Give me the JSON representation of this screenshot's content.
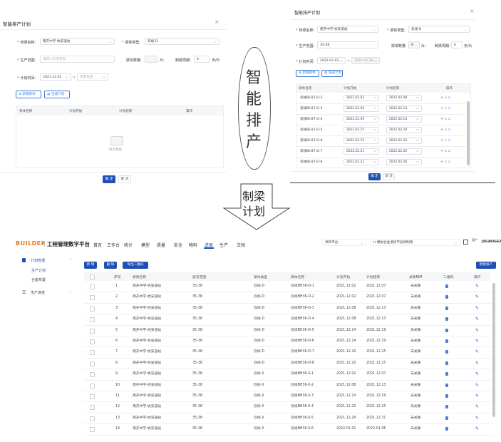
{
  "left_dialog": {
    "title": "智能排产计划",
    "bridge_label": "桥梁名称:",
    "bridge_value": "南开中学-杭安道站",
    "type_label": "梁体类型:",
    "type_value": "双线-D",
    "range_label": "生产范围:",
    "range_placeholder": "请输入桩号范围",
    "count_label": "梁体数量:",
    "count_unit": "片;",
    "cycle_label": "制梁周期:",
    "cycle_value": "6",
    "cycle_unit": "天/片",
    "time_label": "计划时间:",
    "time_start": "2021.12.02",
    "time_end_placeholder": "结束日期",
    "add_btn": "新增梁体",
    "gen_btn": "生成计划",
    "col_name": "梁体名称",
    "col_start": "计划开始",
    "col_end": "计划结束",
    "col_op": "操作",
    "empty_text": "暂无数据",
    "ok_btn": "确 定",
    "cancel_btn": "取 消"
  },
  "center_label": [
    "智",
    "能",
    "排",
    "产"
  ],
  "arrow_label": [
    "制梁",
    "计划"
  ],
  "right_dialog": {
    "title": "智能排产计划",
    "bridge_label": "桥梁名称:",
    "bridge_value": "南开中学-杭安道站",
    "type_label": "梁体类型:",
    "type_value": "双线-D",
    "range_label": "生产范围:",
    "range_value": "35-38",
    "count_label": "梁体数量:",
    "count_value": "8",
    "count_unit": "片;",
    "cycle_label": "制梁周期:",
    "cycle_value": "6",
    "cycle_unit": "天/片",
    "time_label": "计划时间:",
    "time_start": "2022.02.03",
    "time_end": "2022.02.26",
    "add_btn": "新增梁体",
    "gen_btn": "生成计划",
    "col_name": "梁体名称",
    "col_start": "计划开始",
    "col_end": "计划结束",
    "col_op": "操作",
    "rows": [
      {
        "name": "双线BH37-D-2",
        "start": "2022.02.03",
        "end": "2022.02.08"
      },
      {
        "name": "双线BH37-D-3",
        "start": "2022.02.09",
        "end": "2022.02.14"
      },
      {
        "name": "双线BH37-D-4",
        "start": "2022.02.09",
        "end": "2022.02.14"
      },
      {
        "name": "双线BH37-D-5",
        "start": "2022.02.15",
        "end": "2022.02.20"
      },
      {
        "name": "双线BH37-D-6",
        "start": "2022.02.15",
        "end": "2022.02.20"
      },
      {
        "name": "双线BH37-D-7",
        "start": "2022.02.21",
        "end": "2022.02.26"
      },
      {
        "name": "双线BH37-D-8",
        "start": "2022.02.21",
        "end": "2022.02.26"
      }
    ],
    "ok_btn": "确 定",
    "cancel_btn": "取 消"
  },
  "app": {
    "brand": "BUILDER",
    "product": "工程管理数字平台",
    "nav": [
      "首页",
      "工作台",
      "统计",
      "模型",
      "质量",
      "安全",
      "物料",
      "进度",
      "生产",
      "文档"
    ],
    "active_nav": "进度",
    "project_select": "项目平台",
    "path_select": "U 横他合金道桥节段预制场",
    "user_name": "用户",
    "user_id": "J563026627",
    "side_menu": [
      {
        "label": "计划管理",
        "children": [
          "生产计划",
          "台座布置"
        ]
      },
      {
        "label": "生产进度",
        "children": []
      }
    ],
    "toolbar": {
      "add": "新 增",
      "delete": "删 除",
      "export": "导出二维码",
      "smart": "智能排产"
    },
    "columns": [
      "序号",
      "桥梁名称",
      "桩号范围",
      "梁体类型",
      "梁体名称",
      "计划开始",
      "计划结束",
      "关联BIM",
      "二维码",
      "操作"
    ],
    "rows": [
      {
        "no": "1",
        "bridge": "南开中学-杭安道站",
        "range": "35-38",
        "type": "双线-D",
        "name": "双线BH36-D-1",
        "start": "2021.12.02",
        "end": "2021.12.07",
        "bim": "未关联"
      },
      {
        "no": "2",
        "bridge": "南开中学-杭安道站",
        "range": "35-38",
        "type": "双线-D",
        "name": "双线BH36-D-2",
        "start": "2021.12.02",
        "end": "2021.12.07",
        "bim": "未关联"
      },
      {
        "no": "3",
        "bridge": "南开中学-杭安道站",
        "range": "35-38",
        "type": "双线-D",
        "name": "双线BH36-D-3",
        "start": "2021.12.08",
        "end": "2021.12.13",
        "bim": "未关联"
      },
      {
        "no": "4",
        "bridge": "南开中学-杭安道站",
        "range": "35-38",
        "type": "双线-D",
        "name": "双线BH36-D-4",
        "start": "2021.12.08",
        "end": "2021.12.13",
        "bim": "未关联"
      },
      {
        "no": "5",
        "bridge": "南开中学-杭安道站",
        "range": "35-38",
        "type": "双线-D",
        "name": "双线BH36-D-5",
        "start": "2021.12.14",
        "end": "2021.12.19",
        "bim": "未关联"
      },
      {
        "no": "6",
        "bridge": "南开中学-杭安道站",
        "range": "35-38",
        "type": "双线-D",
        "name": "双线BH36-D-6",
        "start": "2021.12.14",
        "end": "2021.12.19",
        "bim": "未关联"
      },
      {
        "no": "7",
        "bridge": "南开中学-杭安道站",
        "range": "35-38",
        "type": "双线-D",
        "name": "双线BH36-D-7",
        "start": "2021.12.20",
        "end": "2021.12.25",
        "bim": "未关联"
      },
      {
        "no": "8",
        "bridge": "南开中学-杭安道站",
        "range": "35-38",
        "type": "双线-D",
        "name": "双线BH36-D-8",
        "start": "2021.12.20",
        "end": "2021.12.25",
        "bim": "未关联"
      },
      {
        "no": "9",
        "bridge": "南开中学-杭安道站",
        "range": "35-38",
        "type": "双线-X",
        "name": "双线BH36-X-1",
        "start": "2021.12.02",
        "end": "2021.12.07",
        "bim": "未关联"
      },
      {
        "no": "10",
        "bridge": "南开中学-杭安道站",
        "range": "35-38",
        "type": "双线-X",
        "name": "双线BH36-X-2",
        "start": "2021.12.08",
        "end": "2021.12.13",
        "bim": "未关联"
      },
      {
        "no": "11",
        "bridge": "南开中学-杭安道站",
        "range": "35-38",
        "type": "双线-X",
        "name": "双线BH36-X-3",
        "start": "2021.12.14",
        "end": "2021.12.19",
        "bim": "未关联"
      },
      {
        "no": "12",
        "bridge": "南开中学-杭安道站",
        "range": "35-38",
        "type": "双线-X",
        "name": "双线BH36-X-4",
        "start": "2021.12.20",
        "end": "2021.12.25",
        "bim": "未关联"
      },
      {
        "no": "13",
        "bridge": "南开中学-杭安道站",
        "range": "35-38",
        "type": "双线-X",
        "name": "双线BH36-X-5",
        "start": "2021.12.26",
        "end": "2021.12.31",
        "bim": "未关联"
      },
      {
        "no": "14",
        "bridge": "南开中学-杭安道站",
        "range": "35-38",
        "type": "双线-X",
        "name": "双线BH36-X-6",
        "start": "2022.01.01",
        "end": "2022.01.06",
        "bim": "未关联"
      }
    ]
  },
  "colors": {
    "primary": "#1f4fb4",
    "link": "#3a7bd5",
    "required": "#e2231a",
    "brand": "#e07b1a",
    "qr": "#4a7ed8"
  }
}
